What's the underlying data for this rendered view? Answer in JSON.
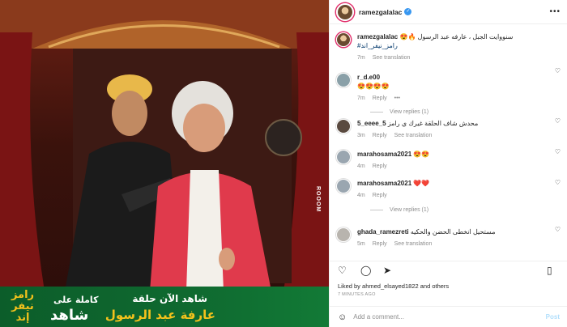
{
  "banner": {
    "show_logo": "رامز نيفر إند",
    "line1": "شاهد الآن حلقة",
    "line2": "كاملة على",
    "line3": "عارفة عبد الرسول",
    "platform": "شاهد"
  },
  "watermark": "ROOOM",
  "post": {
    "username": "ramezgalalac",
    "caption_user": "ramezgalalac",
    "caption_text": "😍🔥 سنووايت الجبل ، عارفه عبد الرسول",
    "caption_tag": "#رامز_نيفر_اند",
    "caption_age": "7m",
    "see_translation": "See translation",
    "likes": "Liked by ahmed_elsayed1822 and others",
    "posted": "7 MINUTES AGO",
    "add_comment_placeholder": "Add a comment...",
    "post_label": "Post"
  },
  "comments": [
    {
      "user": "r_d.e00",
      "text": "😍😍😍😍",
      "age": "7m",
      "reply": "Reply",
      "extra": "•••"
    },
    {
      "user": "5_eeee_5",
      "text": "محدش شاف الحلقة غيرك ي رامز",
      "age": "3m",
      "reply": "Reply",
      "translation": "See translation"
    },
    {
      "user": "marahosama2021",
      "text": "😍😍",
      "age": "4m",
      "reply": "Reply"
    },
    {
      "user": "marahosama2021",
      "text": "❤️❤️",
      "age": "4m",
      "reply": "Reply"
    },
    {
      "user": "ghada_ramezreti",
      "text": "مستحيل انخطى الحضن والحكيه",
      "age": "5m",
      "reply": "Reply",
      "translation": "See translation"
    }
  ],
  "view_replies": "View replies (1)",
  "icons": {
    "verified": "verified-badge-icon",
    "more": "more-options-icon",
    "heart": "heart-icon",
    "comment": "comment-icon",
    "share": "share-icon",
    "bookmark": "bookmark-icon",
    "emoji": "emoji-icon"
  },
  "colors": {
    "link": "#3897f0",
    "banner_green": "#0f6a30",
    "banner_gold": "#f4c21c"
  }
}
